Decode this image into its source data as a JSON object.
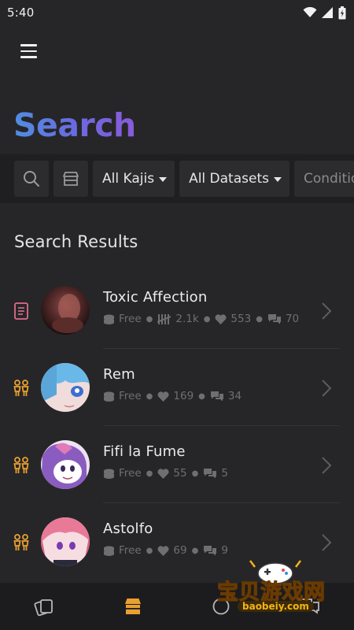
{
  "status_bar": {
    "time": "5:40",
    "icons": [
      "wifi-icon",
      "signal-icon",
      "battery-icon"
    ]
  },
  "header": {
    "menu_icon": "hamburger-menu-icon",
    "title": "Search"
  },
  "filters": {
    "icons": [
      "search-icon",
      "storefront-icon"
    ],
    "chips": [
      {
        "label": "All Kajis",
        "has_dropdown": true
      },
      {
        "label": "All Datasets",
        "has_dropdown": true
      },
      {
        "label": "Conditio",
        "has_dropdown": false
      }
    ]
  },
  "results_section": {
    "title": "Search Results"
  },
  "results": [
    {
      "name": "Toxic Affection",
      "type_icon": "document-icon",
      "price": "Free",
      "messages": "2.1k",
      "likes": "553",
      "comments": "70"
    },
    {
      "name": "Rem",
      "type_icon": "people-icon",
      "price": "Free",
      "likes": "169",
      "comments": "34"
    },
    {
      "name": "Fifi la Fume",
      "type_icon": "people-icon",
      "price": "Free",
      "likes": "55",
      "comments": "5"
    },
    {
      "name": "Astolfo",
      "type_icon": "people-icon",
      "price": "Free",
      "likes": "69",
      "comments": "9"
    }
  ],
  "bottom_nav": [
    "cards-icon",
    "store-icon",
    "home-circle-icon",
    "chat-icon"
  ],
  "watermark": {
    "text": "宝贝游戏网",
    "url": "baobeiy.com"
  },
  "colors": {
    "background": "#262628",
    "accent_gold": "#e8a030",
    "accent_pink": "#e06c8a",
    "title_gradient_start": "#4f8ee0",
    "title_gradient_end": "#8a5ad8"
  }
}
